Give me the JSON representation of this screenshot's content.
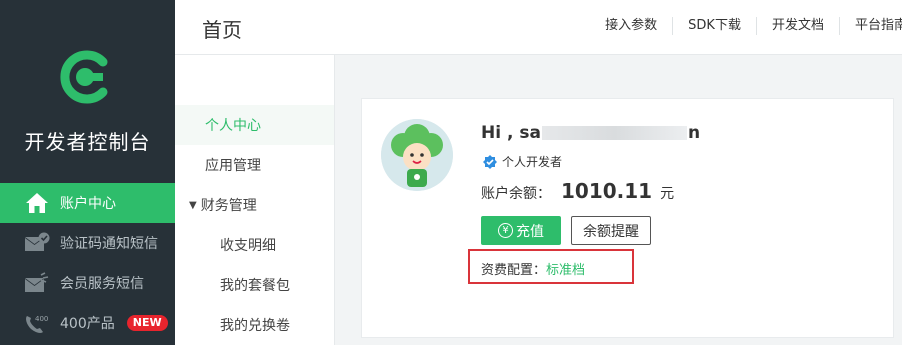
{
  "sidebar": {
    "brand": "开发者控制台",
    "items": [
      {
        "label": "账户中心",
        "icon": "home-icon",
        "active": true
      },
      {
        "label": "验证码通知短信",
        "icon": "verified-mail-icon"
      },
      {
        "label": "会员服务短信",
        "icon": "broadcast-mail-icon"
      },
      {
        "label": "400产品",
        "icon": "phone-400-icon",
        "badge": "NEW"
      }
    ]
  },
  "header": {
    "title": "首页",
    "links": [
      "接入参数",
      "SDK下载",
      "开发文档",
      "平台指南"
    ]
  },
  "submenu": {
    "items": [
      {
        "label": "个人中心",
        "active": true
      },
      {
        "label": "应用管理"
      },
      {
        "label": "财务管理",
        "expanded": true
      },
      {
        "label": "收支明细"
      },
      {
        "label": "我的套餐包"
      },
      {
        "label": "我的兑换卷"
      }
    ]
  },
  "account": {
    "greeting_prefix": "Hi , sa",
    "greeting_suffix": "n",
    "user_type": "个人开发者",
    "balance_label": "账户余额：",
    "balance_amount": "1010.11",
    "balance_unit": "元",
    "recharge_symbol": "¥",
    "recharge_label": "充值",
    "remind_label": "余额提醒",
    "plan_label": "资费配置：",
    "plan_value": "标准档"
  },
  "colors": {
    "accent": "#2ebd6b",
    "sidebar_bg": "#273138",
    "badge_red": "#e8242d",
    "highlight_box": "#d9343a"
  }
}
